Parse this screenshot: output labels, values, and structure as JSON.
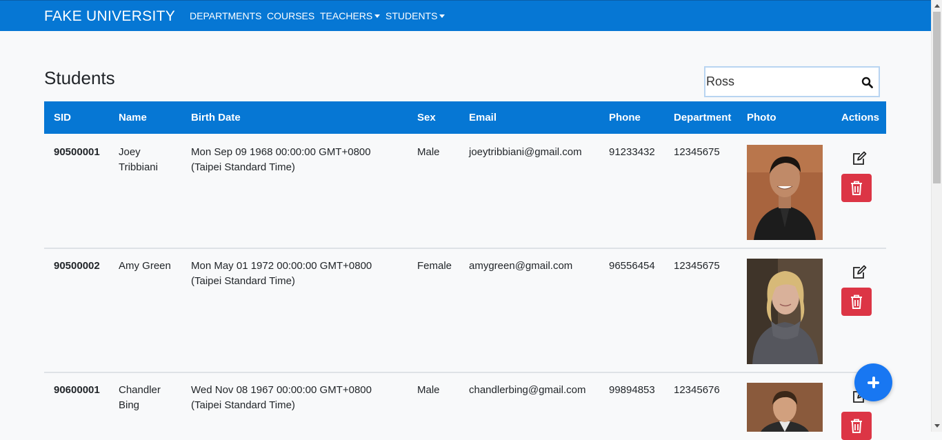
{
  "navbar": {
    "brand": "FAKE UNIVERSITY",
    "items": [
      {
        "label": "DEPARTMENTS",
        "dropdown": false
      },
      {
        "label": "COURSES",
        "dropdown": false
      },
      {
        "label": "TEACHERS",
        "dropdown": true
      },
      {
        "label": "STUDENTS",
        "dropdown": true
      }
    ]
  },
  "page": {
    "title": "Students"
  },
  "search": {
    "value": "Ross",
    "icon": "search-icon"
  },
  "table": {
    "headers": [
      "SID",
      "Name",
      "Birth Date",
      "Sex",
      "Email",
      "Phone",
      "Department",
      "Photo",
      "Actions"
    ],
    "rows": [
      {
        "sid": "90500001",
        "name_line1": "Joey",
        "name_line2": "Tribbiani",
        "birth_line1": "Mon Sep 09 1968 00:00:00 GMT+0800",
        "birth_line2": "(Taipei Standard Time)",
        "sex": "Male",
        "email": "joeytribbiani@gmail.com",
        "phone": "91233432",
        "department": "12345675"
      },
      {
        "sid": "90500002",
        "name_line1": "Amy Green",
        "name_line2": "",
        "birth_line1": "Mon May 01 1972 00:00:00 GMT+0800",
        "birth_line2": "(Taipei Standard Time)",
        "sex": "Female",
        "email": "amygreen@gmail.com",
        "phone": "96556454",
        "department": "12345675"
      },
      {
        "sid": "90600001",
        "name_line1": "Chandler",
        "name_line2": "Bing",
        "birth_line1": "Wed Nov 08 1967 00:00:00 GMT+0800",
        "birth_line2": "(Taipei Standard Time)",
        "sex": "Male",
        "email": "chandlerbing@gmail.com",
        "phone": "99894853",
        "department": "12345676"
      }
    ]
  },
  "icons": {
    "edit": "edit-icon",
    "delete": "trash-icon",
    "add": "plus-icon"
  },
  "colors": {
    "primary": "#0677d4",
    "danger": "#dc3545",
    "fab": "#1877f2"
  }
}
